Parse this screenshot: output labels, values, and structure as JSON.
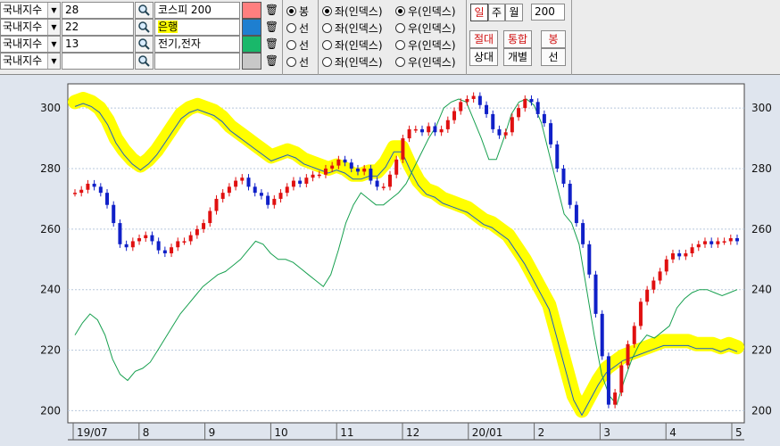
{
  "toolbar": {
    "rows": [
      {
        "category": "국내지수",
        "code": "28",
        "name": "코스피 200",
        "swatch": "#ff7f7f",
        "mode": "봉",
        "mode_on": true,
        "left_label": "좌(인덱스)",
        "left_on": true,
        "right_label": "우(인덱스)",
        "right_on": true
      },
      {
        "category": "국내지수",
        "code": "22",
        "name": "은행",
        "swatch": "#1e7fd0",
        "mode": "선",
        "mode_on": false,
        "left_label": "좌(인덱스)",
        "left_on": false,
        "right_label": "우(인덱스)",
        "right_on": false
      },
      {
        "category": "국내지수",
        "code": "13",
        "name": "전기,전자",
        "swatch": "#19b86a",
        "mode": "선",
        "mode_on": false,
        "left_label": "좌(인덱스)",
        "left_on": false,
        "right_label": "우(인덱스)",
        "right_on": false
      },
      {
        "category": "국내지수",
        "code": "",
        "name": "",
        "swatch": "#c8c8c8",
        "mode": "선",
        "mode_on": false,
        "left_label": "좌(인덱스)",
        "left_on": false,
        "right_label": "우(인덱스)",
        "right_on": false
      }
    ],
    "period": {
      "day": "일",
      "week": "주",
      "month": "월",
      "count": "200"
    },
    "buttons": {
      "absolute": "절대",
      "relative": "상대",
      "merged": "통합",
      "separate": "개별",
      "candle": "봉",
      "line": "선"
    },
    "icons": {
      "dropdown": "chevron-down-icon",
      "search": "magnifier-icon",
      "delete": "trash-icon"
    }
  },
  "chart_data": {
    "type": "line",
    "title": "",
    "y_axis": {
      "ticks": [
        200,
        220,
        240,
        260,
        280,
        300
      ],
      "range": [
        196,
        308
      ],
      "grid": true
    },
    "x_axis": {
      "labels": [
        "19/07",
        "8",
        "9",
        "10",
        "11",
        "12",
        "20/01",
        "2",
        "3",
        "4",
        "5"
      ]
    },
    "colors": {
      "up": "#e01010",
      "down": "#1020c8",
      "bank": "#1e60c0",
      "elec": "#18a050",
      "highlight": "#ffff00"
    },
    "series": [
      {
        "name": "코스피 200",
        "style": "candle",
        "values": [
          272,
          273,
          275,
          274,
          272,
          268,
          262,
          255,
          254,
          256,
          257,
          258,
          256,
          253,
          252,
          254,
          256,
          256,
          258,
          260,
          262,
          266,
          270,
          272,
          274,
          276,
          277,
          274,
          272,
          271,
          268,
          270,
          272,
          274,
          276,
          275,
          277,
          278,
          278,
          280,
          281,
          283,
          282,
          280,
          279,
          280,
          276,
          274,
          274,
          278,
          283,
          290,
          293,
          293,
          292,
          294,
          292,
          293,
          296,
          299,
          302,
          303,
          304,
          301,
          298,
          293,
          291,
          292,
          297,
          300,
          303,
          302,
          298,
          295,
          288,
          280,
          275,
          268,
          262,
          255,
          245,
          232,
          218,
          202,
          206,
          215,
          222,
          228,
          236,
          240,
          243,
          246,
          250,
          252,
          251,
          252,
          254,
          255,
          256,
          255,
          256,
          256,
          257,
          256
        ]
      },
      {
        "name": "은행",
        "style": "line",
        "values": [
          302,
          303,
          302,
          300,
          296,
          290,
          286,
          283,
          281,
          283,
          286,
          290,
          294,
          298,
          300,
          301,
          300,
          299,
          297,
          294,
          292,
          290,
          288,
          286,
          284,
          285,
          286,
          285,
          283,
          282,
          281,
          280,
          281,
          280,
          278,
          278,
          279,
          279,
          282,
          287,
          287,
          281,
          276,
          273,
          272,
          270,
          269,
          268,
          267,
          265,
          263,
          262,
          260,
          258,
          254,
          250,
          245,
          240,
          235,
          225,
          215,
          205,
          200,
          205,
          210,
          214,
          216,
          218,
          219,
          220,
          221,
          222,
          223,
          223,
          223,
          223,
          222,
          222,
          222,
          221,
          222,
          221
        ]
      },
      {
        "name": "전기,전자",
        "style": "line",
        "values": [
          225,
          229,
          232,
          230,
          225,
          217,
          212,
          210,
          213,
          214,
          216,
          220,
          224,
          228,
          232,
          235,
          238,
          241,
          243,
          245,
          246,
          248,
          250,
          253,
          256,
          255,
          252,
          250,
          250,
          249,
          247,
          245,
          243,
          241,
          245,
          253,
          262,
          268,
          272,
          270,
          268,
          268,
          270,
          272,
          275,
          280,
          285,
          290,
          294,
          300,
          302,
          303,
          302,
          296,
          290,
          283,
          283,
          290,
          298,
          302,
          303,
          301,
          295,
          285,
          275,
          265,
          262,
          255,
          240,
          225,
          212,
          205,
          202,
          210,
          217,
          222,
          225,
          224,
          226,
          228,
          234,
          237,
          239,
          240,
          240,
          239,
          238,
          239,
          240
        ]
      }
    ]
  }
}
